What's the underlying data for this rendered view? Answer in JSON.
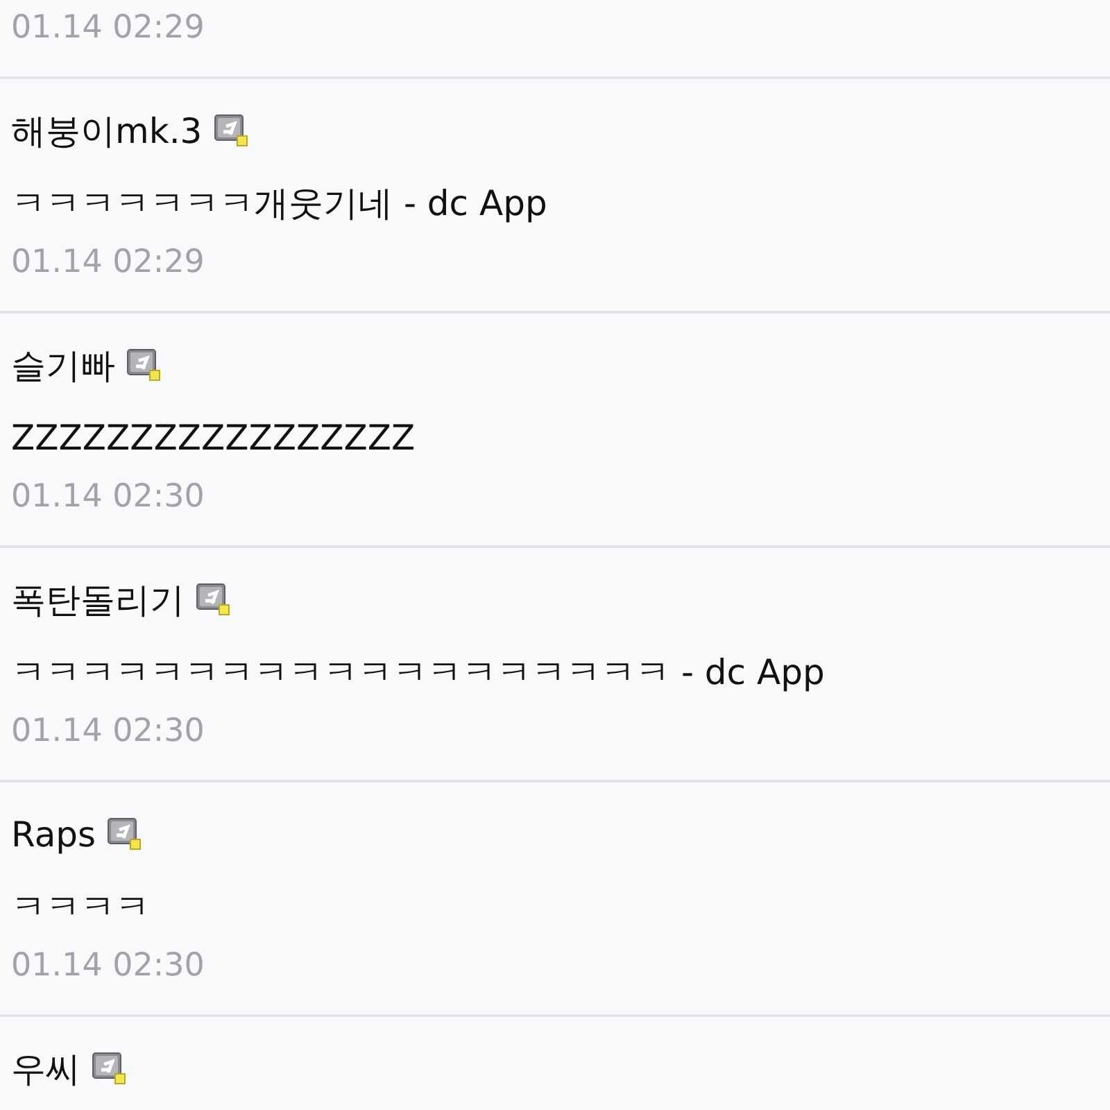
{
  "top_comment": {
    "date": "01.14 02:29"
  },
  "comments": [
    {
      "author": "해붕이mk.3",
      "body": "ㅋㅋㅋㅋㅋㅋㅋ개웃기네 - dc App",
      "date": "01.14 02:29"
    },
    {
      "author": "슬기빠",
      "body": "ZZZZZZZZZZZZZZZZZ",
      "date": "01.14 02:30"
    },
    {
      "author": "폭탄돌리기",
      "body": "ㅋㅋㅋㅋㅋㅋㅋㅋㅋㅋㅋㅋㅋㅋㅋㅋㅋㅋㅋ - dc App",
      "date": "01.14 02:30"
    },
    {
      "author": "Raps",
      "body": "ㅋㅋㅋㅋ",
      "date": "01.14 02:30"
    },
    {
      "author": "우씨"
    }
  ]
}
